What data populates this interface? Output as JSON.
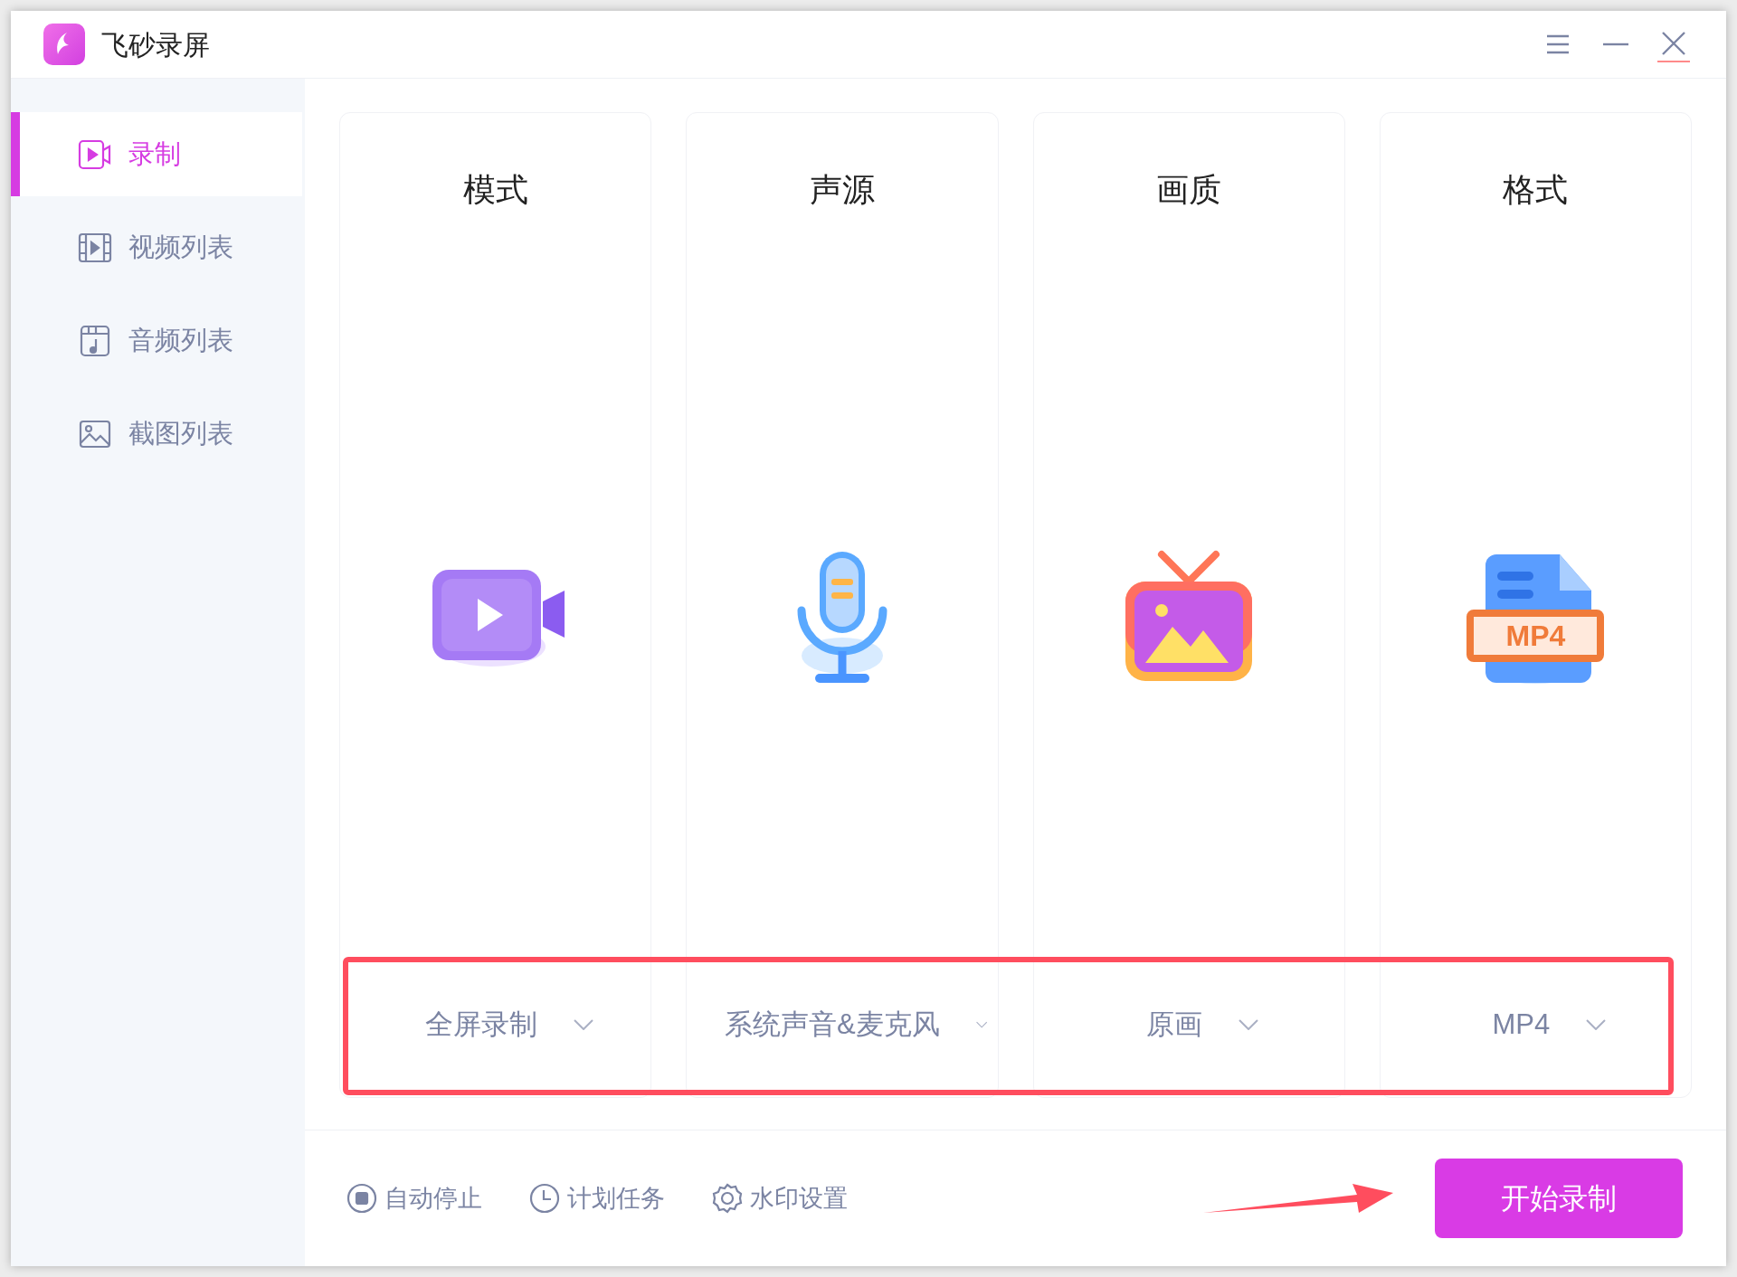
{
  "window": {
    "title": "飞砂录屏"
  },
  "sidebar": {
    "items": [
      {
        "label": "录制",
        "kind": "record",
        "selected": true
      },
      {
        "label": "视频列表",
        "kind": "video",
        "selected": false
      },
      {
        "label": "音频列表",
        "kind": "audio",
        "selected": false
      },
      {
        "label": "截图列表",
        "kind": "image",
        "selected": false
      }
    ]
  },
  "cards": [
    {
      "title": "模式",
      "kind": "mode",
      "value": "全屏录制"
    },
    {
      "title": "声源",
      "kind": "sound",
      "value": "系统声音&麦克风"
    },
    {
      "title": "画质",
      "kind": "quality",
      "value": "原画"
    },
    {
      "title": "格式",
      "kind": "format",
      "value": "MP4",
      "icon_label": "MP4"
    }
  ],
  "highlight": {
    "shown": true
  },
  "bottom_bar": {
    "options": [
      {
        "label": "自动停止",
        "kind": "stop"
      },
      {
        "label": "计划任务",
        "kind": "clock"
      },
      {
        "label": "水印设置",
        "kind": "gear"
      }
    ],
    "start_button": "开始录制"
  }
}
